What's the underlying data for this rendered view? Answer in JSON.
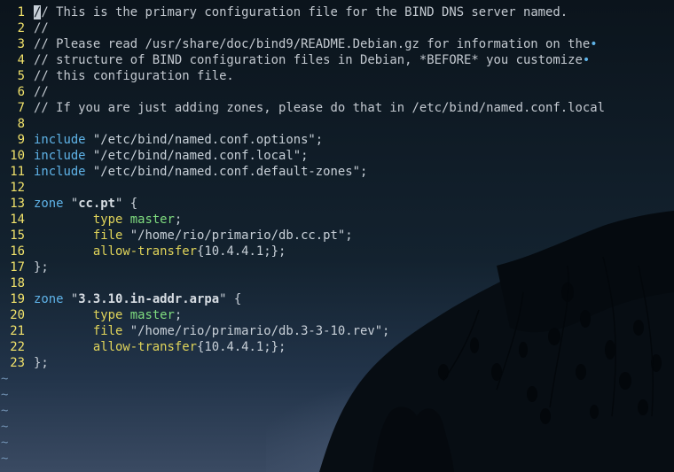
{
  "editor": {
    "lines": [
      {
        "num": "1",
        "segs": [
          {
            "t": "/",
            "c": "cursor"
          },
          {
            "t": "/ This is the primary configuration file for the BIND DNS server named.",
            "c": "c-comment"
          }
        ]
      },
      {
        "num": "2",
        "segs": [
          {
            "t": "//",
            "c": "c-comment"
          }
        ]
      },
      {
        "num": "3",
        "segs": [
          {
            "t": "// Please read /usr/share/doc/bind9/README.Debian.gz for information on the",
            "c": "c-comment"
          },
          {
            "t": "•",
            "c": "c-dot"
          }
        ]
      },
      {
        "num": "4",
        "segs": [
          {
            "t": "// structure of BIND configuration files in Debian, *BEFORE* you customize",
            "c": "c-comment"
          },
          {
            "t": "•",
            "c": "c-dot"
          }
        ]
      },
      {
        "num": "5",
        "segs": [
          {
            "t": "// this configuration file.",
            "c": "c-comment"
          }
        ]
      },
      {
        "num": "6",
        "segs": [
          {
            "t": "//",
            "c": "c-comment"
          }
        ]
      },
      {
        "num": "7",
        "segs": [
          {
            "t": "// If you are just adding zones, please do that in /etc/bind/named.conf.local",
            "c": "c-comment"
          }
        ]
      },
      {
        "num": "8",
        "segs": []
      },
      {
        "num": "9",
        "segs": [
          {
            "t": "include",
            "c": "c-kw"
          },
          {
            "t": " \"/etc/bind/named.conf.options\";",
            "c": "c-str"
          }
        ]
      },
      {
        "num": "10",
        "segs": [
          {
            "t": "include",
            "c": "c-kw"
          },
          {
            "t": " \"/etc/bind/named.conf.local\";",
            "c": "c-str"
          }
        ]
      },
      {
        "num": "11",
        "segs": [
          {
            "t": "include",
            "c": "c-kw"
          },
          {
            "t": " \"/etc/bind/named.conf.default-zones\";",
            "c": "c-str"
          }
        ]
      },
      {
        "num": "12",
        "segs": []
      },
      {
        "num": "13",
        "segs": [
          {
            "t": "zone",
            "c": "c-kw"
          },
          {
            "t": " \"",
            "c": "c-str"
          },
          {
            "t": "cc.pt",
            "c": "c-str-bold"
          },
          {
            "t": "\" {",
            "c": "c-str"
          }
        ]
      },
      {
        "num": "14",
        "segs": [
          {
            "t": "        ",
            "c": "code"
          },
          {
            "t": "type",
            "c": "c-type"
          },
          {
            "t": " ",
            "c": "code"
          },
          {
            "t": "master",
            "c": "c-val"
          },
          {
            "t": ";",
            "c": "code"
          }
        ]
      },
      {
        "num": "15",
        "segs": [
          {
            "t": "        ",
            "c": "code"
          },
          {
            "t": "file",
            "c": "c-type"
          },
          {
            "t": " \"/home/rio/primario/db.cc.pt\";",
            "c": "c-str"
          }
        ]
      },
      {
        "num": "16",
        "segs": [
          {
            "t": "        ",
            "c": "code"
          },
          {
            "t": "allow-transfer",
            "c": "c-type"
          },
          {
            "t": "{10.4.4.1;};",
            "c": "code"
          }
        ]
      },
      {
        "num": "17",
        "segs": [
          {
            "t": "};",
            "c": "code"
          }
        ]
      },
      {
        "num": "18",
        "segs": []
      },
      {
        "num": "19",
        "segs": [
          {
            "t": "zone",
            "c": "c-kw"
          },
          {
            "t": " \"",
            "c": "c-str"
          },
          {
            "t": "3.3.10.in-addr.arpa",
            "c": "c-str-bold"
          },
          {
            "t": "\" {",
            "c": "c-str"
          }
        ]
      },
      {
        "num": "20",
        "segs": [
          {
            "t": "        ",
            "c": "code"
          },
          {
            "t": "type",
            "c": "c-type"
          },
          {
            "t": " ",
            "c": "code"
          },
          {
            "t": "master",
            "c": "c-val"
          },
          {
            "t": ";",
            "c": "code"
          }
        ]
      },
      {
        "num": "21",
        "segs": [
          {
            "t": "        ",
            "c": "code"
          },
          {
            "t": "file",
            "c": "c-type"
          },
          {
            "t": " \"/home/rio/primario/db.3-3-10.rev\";",
            "c": "c-str"
          }
        ]
      },
      {
        "num": "22",
        "segs": [
          {
            "t": "        ",
            "c": "code"
          },
          {
            "t": "allow-transfer",
            "c": "c-type"
          },
          {
            "t": "{10.4.4.1;};",
            "c": "code"
          }
        ]
      },
      {
        "num": "23",
        "segs": [
          {
            "t": "};",
            "c": "code"
          }
        ]
      }
    ],
    "empty_marker": "~",
    "empty_line_count": 6
  },
  "colors": {
    "background": "#0d1720",
    "line_number": "#f2e36b",
    "keyword": "#5fb3e8",
    "property": "#e0d45a",
    "value": "#7fdc7f",
    "text": "#c8d0d8",
    "tilde": "#6f8fb0"
  }
}
